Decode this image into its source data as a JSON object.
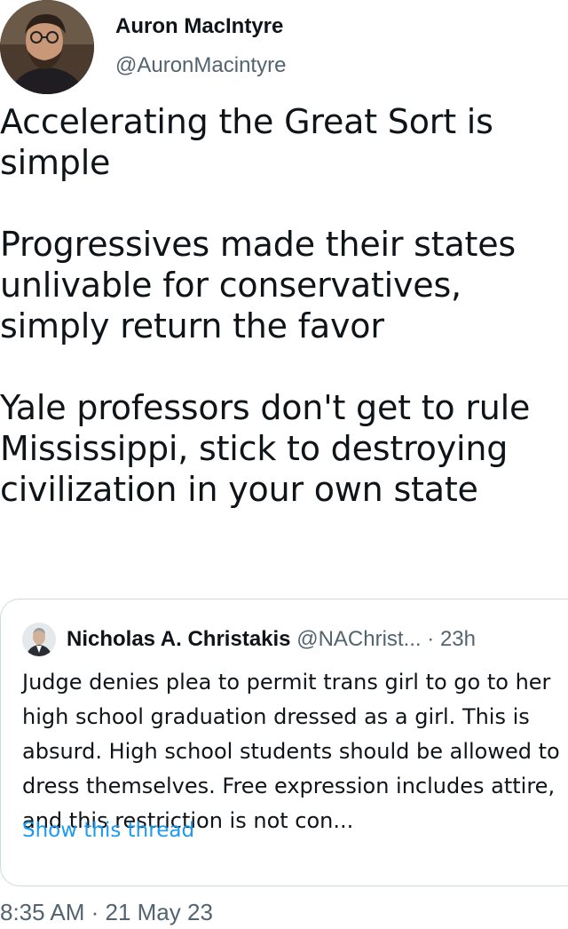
{
  "author": {
    "name": "Auron MacIntyre",
    "handle": "@AuronMacintyre"
  },
  "tweet": {
    "paragraphs": [
      "Accelerating the Great Sort is simple",
      "Progressives made their states unlivable for conservatives, simply return the favor",
      "Yale professors don't get to rule Mississippi, stick to destroying civilization in your own state"
    ],
    "timestamp": "8:35 AM · 21 May 23"
  },
  "quoted_tweet": {
    "name": "Nicholas A. Christakis",
    "handle": "@NAChrist...",
    "separator": "·",
    "time": "23h",
    "text": "Judge denies plea to permit trans girl to go to her high school graduation dressed as a girl. This is absurd. High school students should be allowed to dress themselves. Free expression includes attire, and this restriction is not con...",
    "show_thread_label": "Show this thread"
  },
  "colors": {
    "text_primary": "#0f1419",
    "text_secondary": "#536471",
    "link": "#1d9bf0",
    "border": "#cfd9de"
  }
}
